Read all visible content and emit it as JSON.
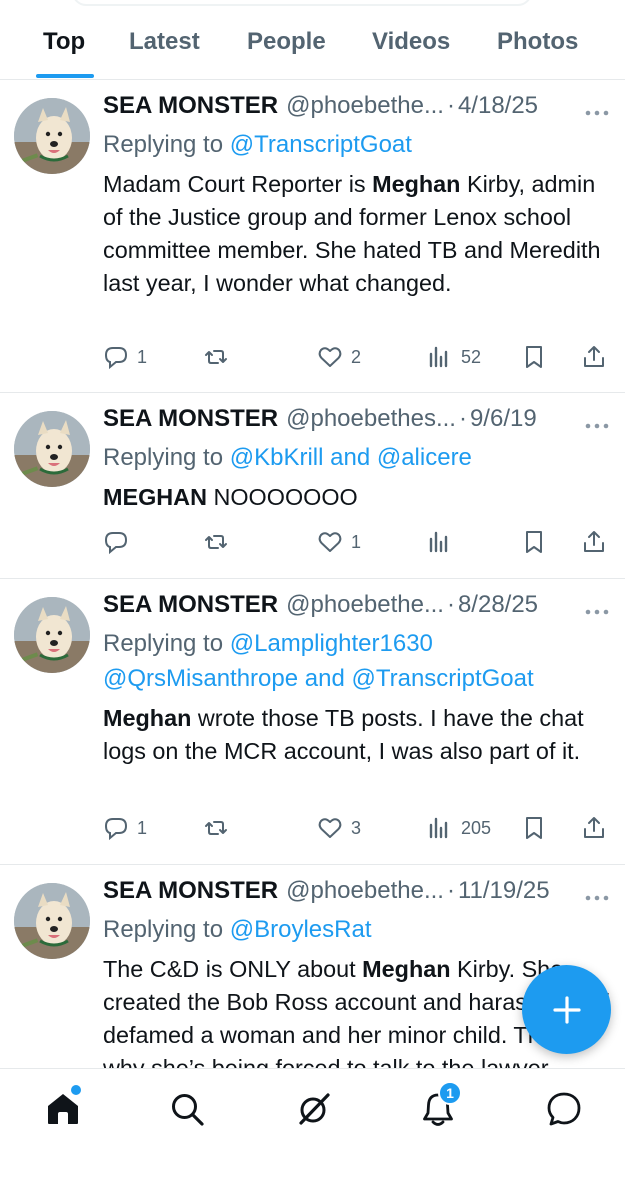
{
  "tabs": [
    {
      "label": "Top",
      "active": true
    },
    {
      "label": "Latest"
    },
    {
      "label": "People"
    },
    {
      "label": "Videos"
    },
    {
      "label": "Photos"
    }
  ],
  "tweets": [
    {
      "name": "SEA MONSTER",
      "handle": "@phoebethe...",
      "date": "4/18/25",
      "replying_to": "Replying to",
      "mentions": "@TranscriptGoat",
      "text_parts": [
        {
          "t": "Madam Court Reporter is ",
          "b": false
        },
        {
          "t": "Meghan",
          "b": true
        },
        {
          "t": " Kirby, admin of the Justice group and former Lenox school committee member. She hated TB and Meredith last year, I wonder what changed.",
          "b": false
        }
      ],
      "replies": "1",
      "reposts": "",
      "likes": "2",
      "views": "52"
    },
    {
      "name": "SEA MONSTER",
      "handle": "@phoebethes...",
      "date": "9/6/19",
      "replying_to": "Replying to",
      "mentions": "@KbKrill and @alicere",
      "text_parts": [
        {
          "t": "MEGHAN",
          "b": true
        },
        {
          "t": " NOOOOOOO",
          "b": false
        }
      ],
      "replies": "",
      "reposts": "",
      "likes": "1",
      "views": ""
    },
    {
      "name": "SEA MONSTER",
      "handle": "@phoebethe...",
      "date": "8/28/25",
      "replying_to": "Replying to",
      "mentions": "@Lamplighter1630 @QrsMisanthrope and @TranscriptGoat",
      "text_parts": [
        {
          "t": "Meghan",
          "b": true
        },
        {
          "t": " wrote those TB posts. I have the chat logs on the MCR account, I was also part of it.",
          "b": false
        }
      ],
      "replies": "1",
      "reposts": "",
      "likes": "3",
      "views": "205"
    },
    {
      "name": "SEA MONSTER",
      "handle": "@phoebethe...",
      "date": "11/19/25",
      "replying_to": "Replying to",
      "mentions": "@BroylesRat",
      "text_parts": [
        {
          "t": "The C&D is ONLY about ",
          "b": false
        },
        {
          "t": "Meghan",
          "b": true
        },
        {
          "t": " Kirby. She created the Bob Ross account and harassed and defamed a woman and her minor child. That’s why she’s being forced to talk to the lawyer.",
          "b": false
        }
      ],
      "replies": "",
      "reposts": "",
      "likes": "",
      "views": ""
    }
  ],
  "bottom_nav": [
    {
      "icon": "home-icon",
      "active": true
    },
    {
      "icon": "search-icon"
    },
    {
      "icon": "grok-icon"
    },
    {
      "icon": "bell-icon",
      "badge": "1"
    },
    {
      "icon": "messages-icon"
    }
  ],
  "fab_icon": "plus-icon",
  "colors": {
    "accent": "#1d9bf0",
    "muted": "#536471",
    "text": "#0f1419"
  }
}
